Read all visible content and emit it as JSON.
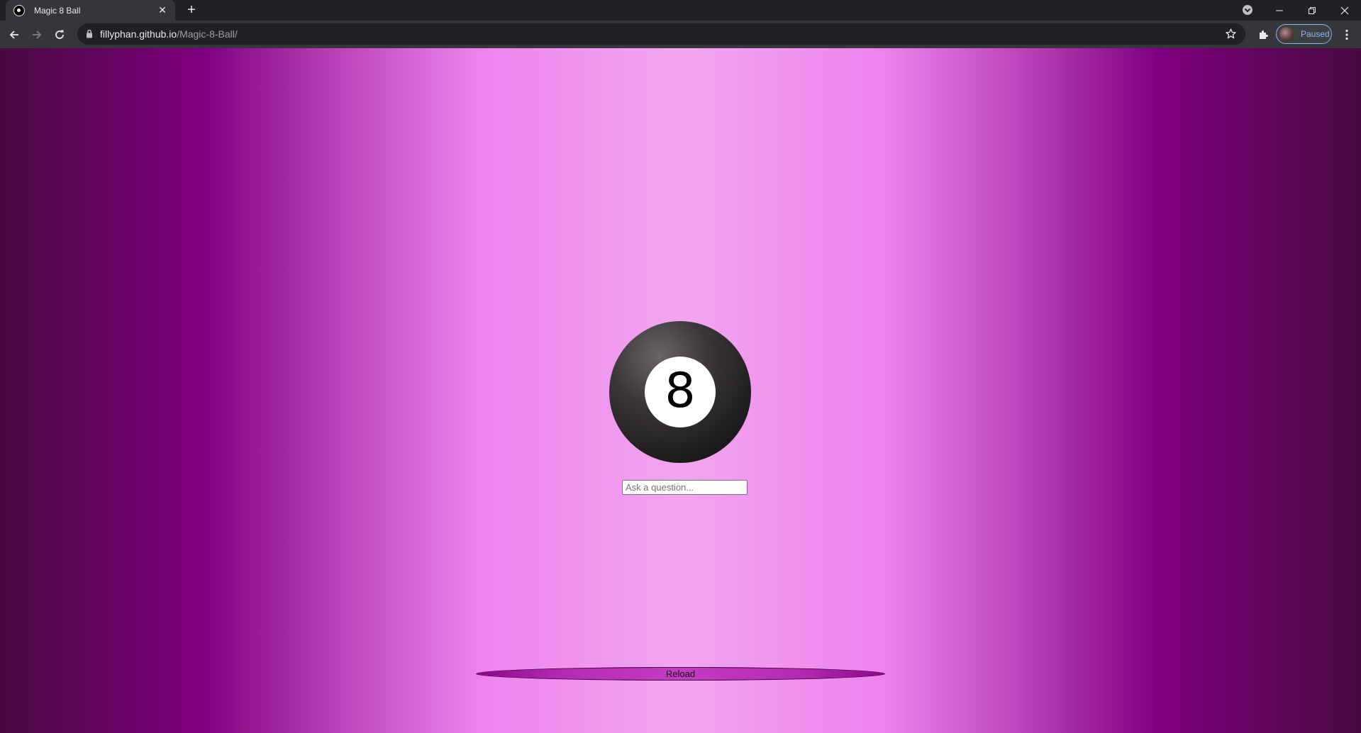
{
  "browser": {
    "tab": {
      "title": "Magic 8 Ball",
      "close_glyph": "✕",
      "favicon": "eightball-favicon-icon"
    },
    "new_tab_glyph": "+",
    "address": {
      "host": "fillyphan.github.io",
      "path": "/Magic-8-Ball/"
    },
    "profile": {
      "status": "Paused",
      "accent": "#8ab4f8"
    },
    "icons": [
      "back-icon",
      "forward-icon",
      "reload-icon",
      "lock-icon",
      "star-icon",
      "extensions-icon",
      "menu-icon",
      "tab-search-icon",
      "minimize-icon",
      "restore-icon",
      "close-window-icon"
    ]
  },
  "page": {
    "eightball": {
      "number": "8"
    },
    "question_input": {
      "placeholder": "Ask a question..."
    },
    "reload_button": {
      "label": "Reload"
    },
    "colors": {
      "background_edge": "#47093f",
      "background_mid": "#800080",
      "background_center": "#ee82ee",
      "button": "#c63ac6"
    }
  }
}
